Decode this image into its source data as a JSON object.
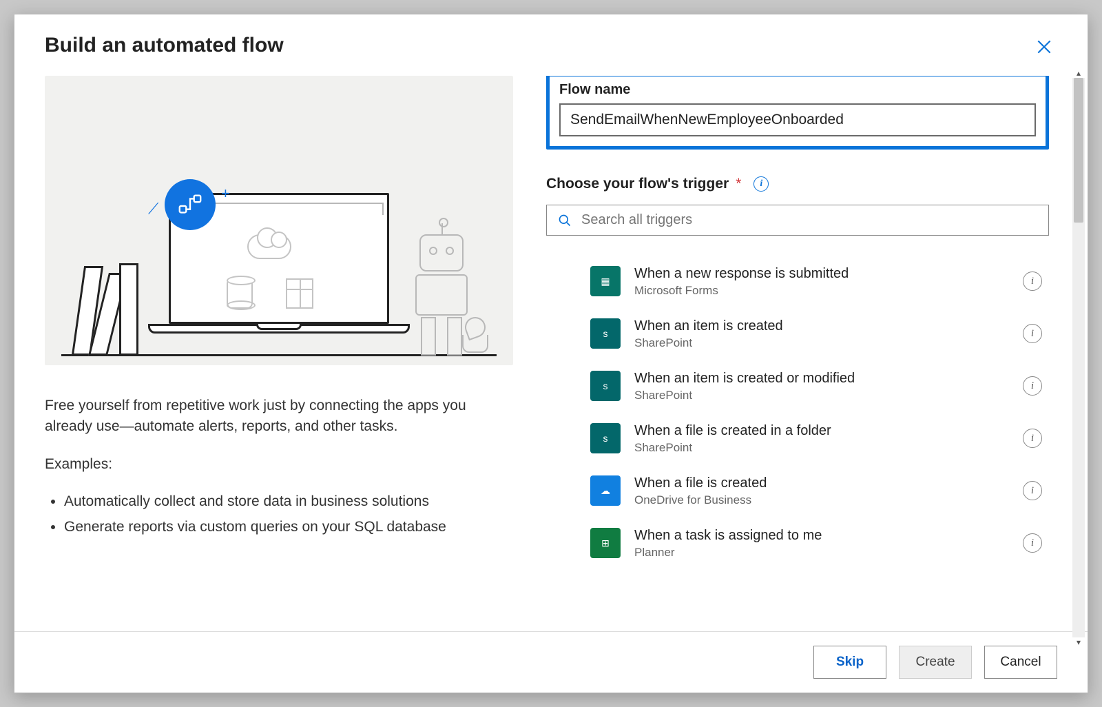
{
  "dialog": {
    "title": "Build an automated flow"
  },
  "left": {
    "description": "Free yourself from repetitive work just by connecting the apps you already use—automate alerts, reports, and other tasks.",
    "examples_label": "Examples:",
    "examples": [
      "Automatically collect and store data in business solutions",
      "Generate reports via custom queries on your SQL database"
    ]
  },
  "form": {
    "flow_name_label": "Flow name",
    "flow_name_value": "SendEmailWhenNewEmployeeOnboarded",
    "trigger_label": "Choose your flow's trigger",
    "search_placeholder": "Search all triggers"
  },
  "triggers": [
    {
      "title": "When a new response is submitted",
      "subtitle": "Microsoft Forms",
      "icon_class": "ico-forms",
      "glyph": "▦"
    },
    {
      "title": "When an item is created",
      "subtitle": "SharePoint",
      "icon_class": "ico-sp",
      "glyph": "s"
    },
    {
      "title": "When an item is created or modified",
      "subtitle": "SharePoint",
      "icon_class": "ico-sp2",
      "glyph": "s"
    },
    {
      "title": "When a file is created in a folder",
      "subtitle": "SharePoint",
      "icon_class": "ico-sp3",
      "glyph": "s"
    },
    {
      "title": "When a file is created",
      "subtitle": "OneDrive for Business",
      "icon_class": "ico-od",
      "glyph": "☁"
    },
    {
      "title": "When a task is assigned to me",
      "subtitle": "Planner",
      "icon_class": "ico-plan",
      "glyph": "⊞"
    }
  ],
  "footer": {
    "skip": "Skip",
    "create": "Create",
    "cancel": "Cancel"
  }
}
